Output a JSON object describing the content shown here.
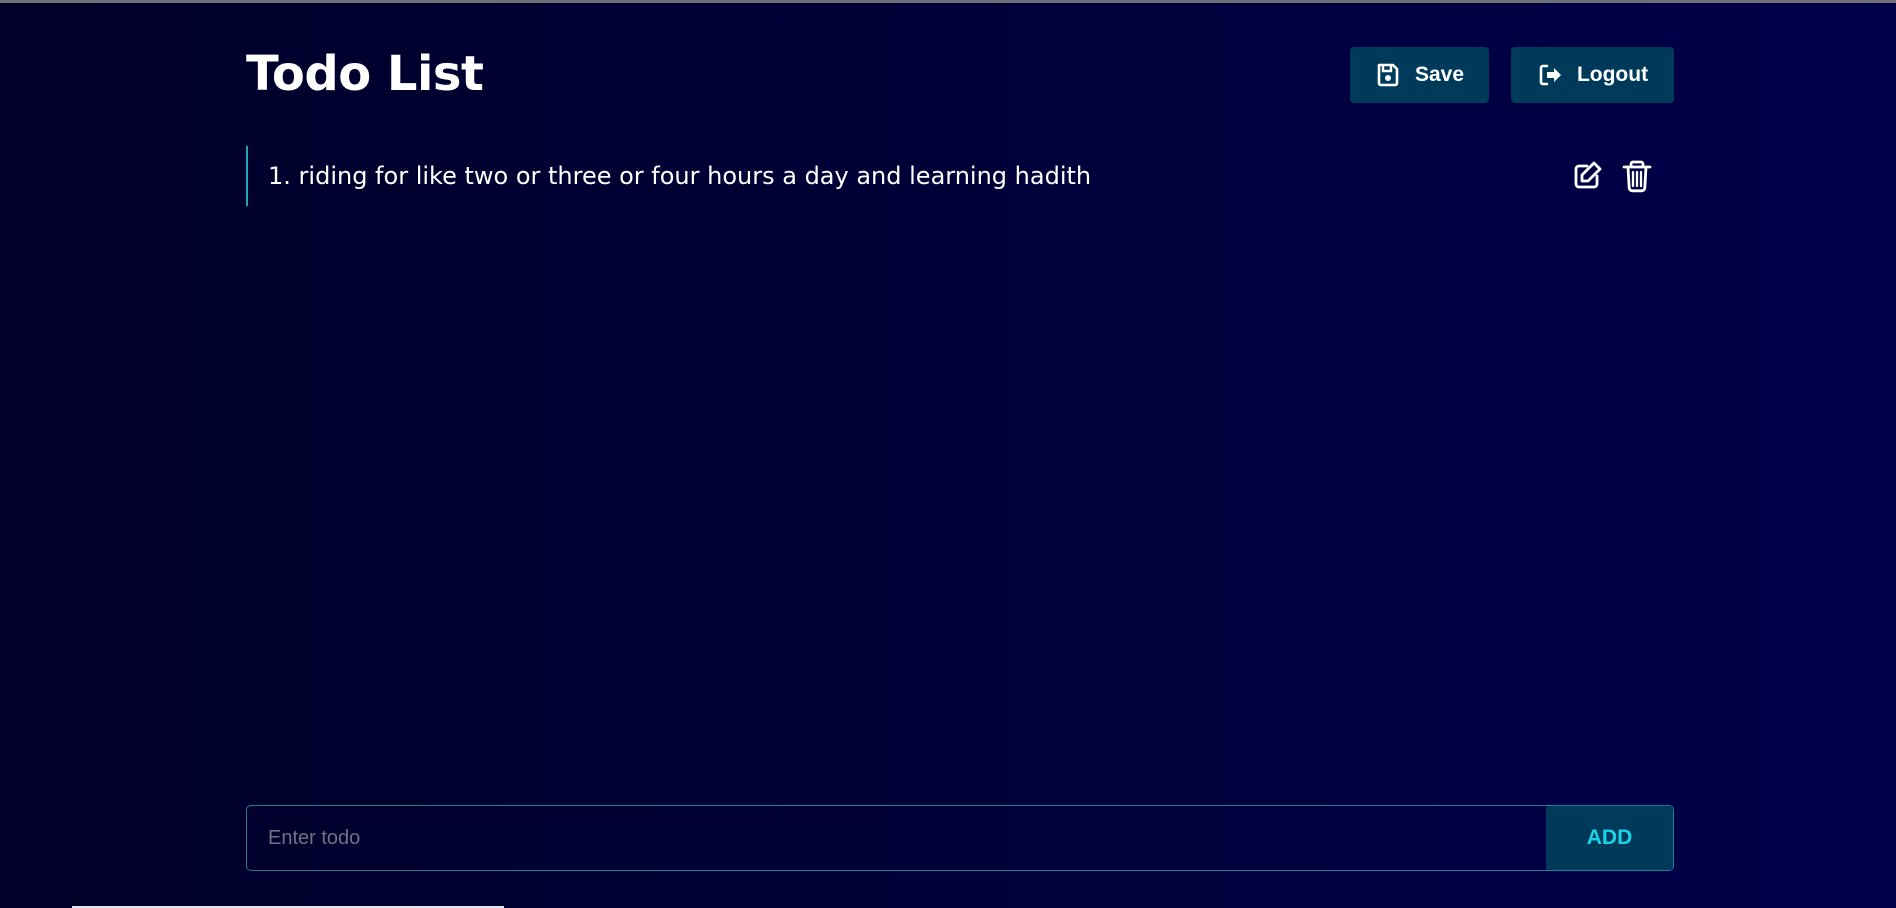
{
  "header": {
    "title": "Todo List",
    "save_label": "Save",
    "logout_label": "Logout",
    "save_icon": "save-icon",
    "logout_icon": "logout-icon"
  },
  "todos": [
    {
      "number": "1",
      "text": "riding for like two or three or four hours a day and learning hadith",
      "edit_icon": "edit-icon",
      "delete_icon": "trash-icon"
    }
  ],
  "input": {
    "placeholder": "Enter todo",
    "value": ""
  },
  "add_button": {
    "label": "ADD"
  },
  "colors": {
    "background": "#000028",
    "button": "#003a5a",
    "accent": "#19d3e8",
    "border": "#1c7f95"
  }
}
